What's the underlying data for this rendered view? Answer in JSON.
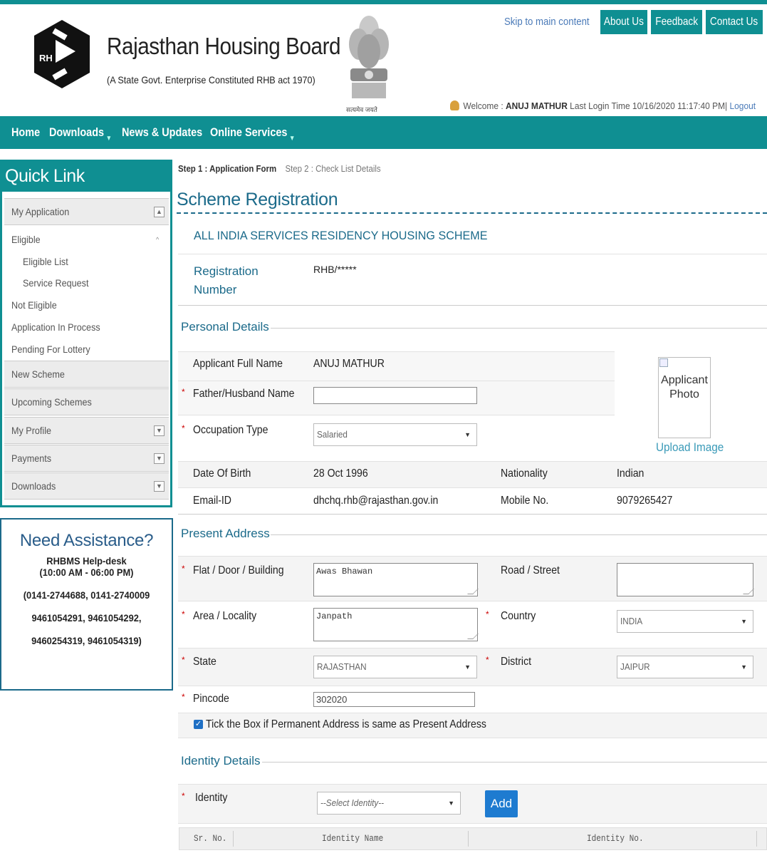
{
  "header": {
    "org_name": "Rajasthan Housing Board",
    "org_subtitle": "(A State Govt. Enterprise Constituted RHB act 1970)",
    "logo_text": "RH",
    "emblem_caption": "सत्यमेव जयते",
    "skip_link": "Skip to main content",
    "top_buttons": [
      "About Us",
      "Feedback",
      "Contact Us"
    ],
    "welcome_prefix": "Welcome :",
    "user_name": "ANUJ MATHUR",
    "last_login": "Last Login Time 10/16/2020 11:17:40 PM|",
    "logout": "Logout"
  },
  "nav": {
    "items": [
      "Home",
      "Downloads",
      "News & Updates",
      "Online Services"
    ]
  },
  "sidebar": {
    "title": "Quick Link",
    "my_application": "My Application",
    "eligible": "Eligible",
    "eligible_list": "Eligible List",
    "service_request": "Service Request",
    "not_eligible": "Not Eligible",
    "app_in_process": "Application In Process",
    "pending_lottery": "Pending For Lottery",
    "new_scheme": "New Scheme",
    "upcoming_schemes": "Upcoming Schemes",
    "my_profile": "My Profile",
    "payments": "Payments",
    "downloads": "Downloads"
  },
  "assistance": {
    "title": "Need Assistance?",
    "line1": "RHBMS Help-desk",
    "line2": "(10:00 AM - 06:00 PM)",
    "line3": "(0141-2744688, 0141-2740009",
    "line4": "9461054291, 9461054292,",
    "line5": "9460254319, 9461054319)"
  },
  "form": {
    "step1": "Step 1 : Application Form",
    "step2": "Step 2 : Check List Details",
    "title": "Scheme Registration",
    "scheme_name": "ALL INDIA SERVICES RESIDENCY HOUSING SCHEME",
    "reg_label": "Registration Number",
    "reg_value": "RHB/*****",
    "personal_section": "Personal Details",
    "applicant_name_label": "Applicant Full Name",
    "applicant_name_value": "ANUJ MATHUR",
    "father_label": "Father/Husband Name",
    "father_value": "",
    "occupation_label": "Occupation Type",
    "occupation_value": "Salaried",
    "photo_alt": "Applicant Photo",
    "upload_image": "Upload Image",
    "dob_label": "Date Of Birth",
    "dob_value": "28 Oct 1996",
    "nationality_label": "Nationality",
    "nationality_value": "Indian",
    "email_label": "Email-ID",
    "email_value": "dhchq.rhb@rajasthan.gov.in",
    "mobile_label": "Mobile No.",
    "mobile_value": "9079265427",
    "present_section": "Present Address",
    "flat_label": "Flat / Door / Building",
    "flat_value": "Awas Bhawan",
    "road_label": "Road / Street",
    "road_value": "",
    "area_label": "Area / Locality",
    "area_value": "Janpath",
    "country_label": "Country",
    "country_value": "INDIA",
    "state_label": "State",
    "state_value": "RAJASTHAN",
    "district_label": "District",
    "district_value": "JAIPUR",
    "pincode_label": "Pincode",
    "pincode_value": "302020",
    "same_address_label": "Tick the Box if Permanent Address is same as Present Address",
    "same_address_checked": true,
    "identity_section": "Identity Details",
    "identity_label": "Identity",
    "identity_placeholder": "--Select Identity--",
    "add_button": "Add",
    "table_headers": [
      "Sr. No.",
      "Identity Name",
      "Identity No."
    ]
  },
  "colors": {
    "teal": "#0f8f92",
    "link_blue": "#1b6a8a",
    "button_blue": "#1e7bd0"
  }
}
